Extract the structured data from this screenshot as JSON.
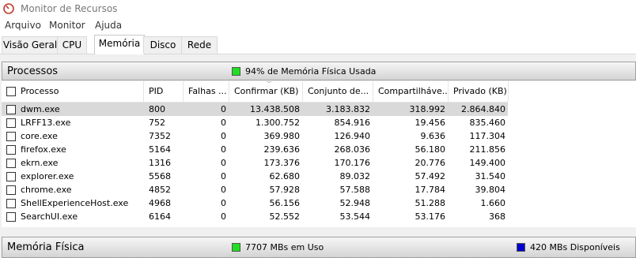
{
  "window": {
    "title": "Monitor de Recursos"
  },
  "menu": [
    "Arquivo",
    "Monitor",
    "Ajuda"
  ],
  "tabs": [
    "Visão Geral",
    "CPU",
    "Memória",
    "Disco",
    "Rede"
  ],
  "processes": {
    "title": "Processos",
    "legend_text": "94% de Memória Física Usada",
    "legend_color": "#22dd22",
    "columns": [
      "Processo",
      "PID",
      "Falhas ...",
      "Confirmar (KB)",
      "Conjunto de...",
      "Compartilháve...",
      "Privado (KB)"
    ],
    "rows": [
      {
        "name": "dwm.exe",
        "pid": "800",
        "faults": "0",
        "commit": "13.438.508",
        "working": "3.183.832",
        "shareable": "318.992",
        "private": "2.864.840"
      },
      {
        "name": "LRFF13.exe",
        "pid": "752",
        "faults": "0",
        "commit": "1.300.752",
        "working": "854.916",
        "shareable": "19.456",
        "private": "835.460"
      },
      {
        "name": "core.exe",
        "pid": "7352",
        "faults": "0",
        "commit": "369.980",
        "working": "126.940",
        "shareable": "9.636",
        "private": "117.304"
      },
      {
        "name": "firefox.exe",
        "pid": "5164",
        "faults": "0",
        "commit": "239.636",
        "working": "268.036",
        "shareable": "56.180",
        "private": "211.856"
      },
      {
        "name": "ekrn.exe",
        "pid": "1316",
        "faults": "0",
        "commit": "173.376",
        "working": "170.176",
        "shareable": "20.776",
        "private": "149.400"
      },
      {
        "name": "explorer.exe",
        "pid": "5568",
        "faults": "0",
        "commit": "62.680",
        "working": "89.032",
        "shareable": "57.492",
        "private": "31.540"
      },
      {
        "name": "chrome.exe",
        "pid": "4852",
        "faults": "0",
        "commit": "57.928",
        "working": "57.588",
        "shareable": "17.784",
        "private": "39.804"
      },
      {
        "name": "ShellExperienceHost.exe",
        "pid": "4968",
        "faults": "0",
        "commit": "56.156",
        "working": "52.948",
        "shareable": "51.288",
        "private": "1.660"
      },
      {
        "name": "SearchUI.exe",
        "pid": "6164",
        "faults": "0",
        "commit": "52.552",
        "working": "53.544",
        "shareable": "53.176",
        "private": "368"
      }
    ]
  },
  "physical_memory": {
    "title": "Memória Física",
    "in_use_text": "7707 MBs em Uso",
    "in_use_color": "#22dd22",
    "available_text": "420 MBs Disponíveis",
    "available_color": "#0000cc"
  }
}
